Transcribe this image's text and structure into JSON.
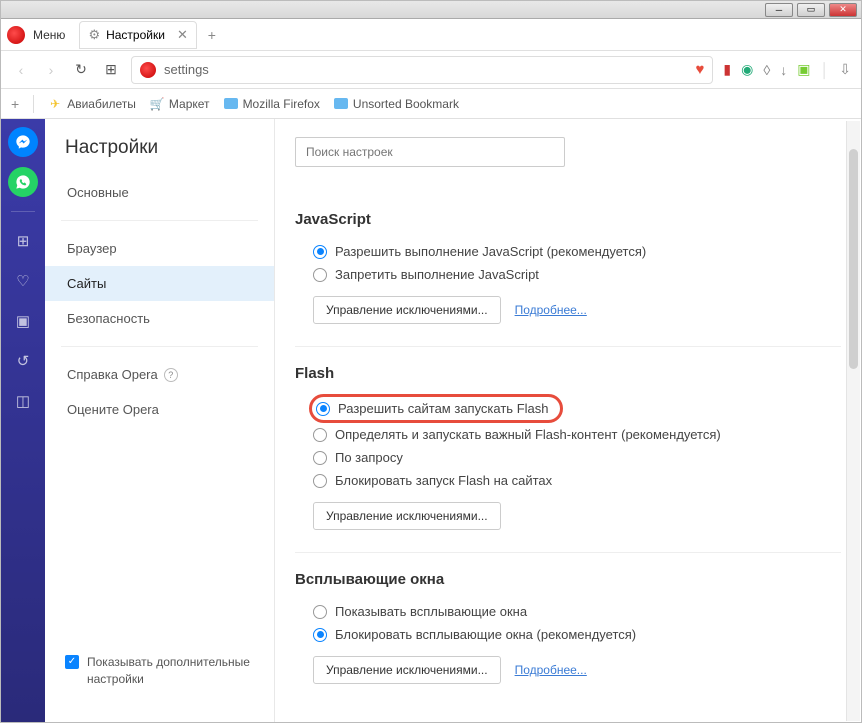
{
  "window": {
    "minimize": "─",
    "maximize": "▭",
    "close": "✕"
  },
  "menu_label": "Меню",
  "tab": {
    "title": "Настройки",
    "close": "✕"
  },
  "newtab": "+",
  "nav": {
    "back": "‹",
    "forward": "›",
    "reload": "↻",
    "speed": "⊞"
  },
  "urlbar": {
    "text": "settings",
    "heart": "♥"
  },
  "ext": {
    "e1": "▮",
    "e2": "◉",
    "e3": "◊",
    "e4": "↓",
    "e5": "▣",
    "sep": "│",
    "e6": "⇩"
  },
  "bookbar": {
    "add": "+",
    "items": [
      {
        "icon": "✈",
        "label": "Авиабилеты",
        "color": "#f4c430"
      },
      {
        "icon": "🛒",
        "label": "Маркет",
        "color": "#2383e2"
      },
      {
        "icon": "folder",
        "label": "Mozilla Firefox"
      },
      {
        "icon": "folder",
        "label": "Unsorted Bookmark"
      }
    ]
  },
  "sidebar": {
    "messenger": "~",
    "whatsapp": "✆",
    "glyphs": [
      "⊞",
      "♡",
      "▣",
      "↺",
      "◫"
    ]
  },
  "settings_nav": {
    "title": "Настройки",
    "items": [
      "Основные",
      "Браузер",
      "Сайты",
      "Безопасность"
    ],
    "help": "Справка Opera",
    "rate": "Оцените Opera",
    "advanced": "Показывать дополнительные настройки"
  },
  "content": {
    "search_placeholder": "Поиск настроек",
    "sections": {
      "javascript": {
        "title": "JavaScript",
        "opt1": "Разрешить выполнение JavaScript (рекомендуется)",
        "opt2": "Запретить выполнение JavaScript",
        "btn": "Управление исключениями...",
        "more": "Подробнее..."
      },
      "flash": {
        "title": "Flash",
        "opt1": "Разрешить сайтам запускать Flash",
        "opt2": "Определять и запускать важный Flash-контент (рекомендуется)",
        "opt3": "По запросу",
        "opt4": "Блокировать запуск Flash на сайтах",
        "btn": "Управление исключениями..."
      },
      "popups": {
        "title": "Всплывающие окна",
        "opt1": "Показывать всплывающие окна",
        "opt2": "Блокировать всплывающие окна (рекомендуется)",
        "btn": "Управление исключениями...",
        "more": "Подробнее..."
      }
    }
  }
}
